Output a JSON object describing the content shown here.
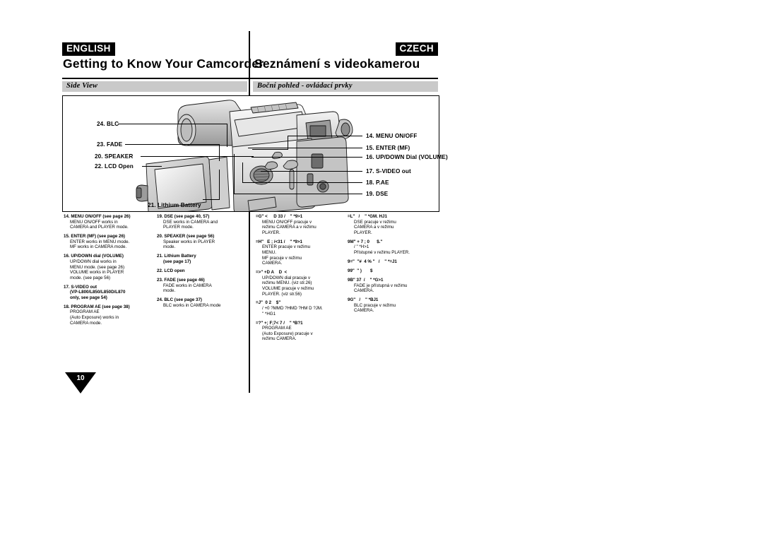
{
  "header": {
    "left_lang": "ENGLISH",
    "right_lang": "CZECH",
    "left_title": "Getting to Know Your Camcorder",
    "right_title": "Seznámení s videokamerou",
    "left_subbar": "Side View",
    "right_subbar": "Boční pohled - ovládací prvky"
  },
  "figure": {
    "labels": [
      {
        "id": "blc",
        "text": "24. BLC"
      },
      {
        "id": "fade",
        "text": "23. FADE"
      },
      {
        "id": "speaker",
        "text": "20. SPEAKER"
      },
      {
        "id": "lcd-open",
        "text": "22. LCD Open"
      },
      {
        "id": "menu",
        "text": "14. MENU ON/OFF"
      },
      {
        "id": "enter",
        "text": "15. ENTER (MF)"
      },
      {
        "id": "updown",
        "text": "16. UP/DOWN Dial (VOLUME)"
      },
      {
        "id": "svideo",
        "text": "17. S-VIDEO out"
      },
      {
        "id": "pae",
        "text": "18. P.AE"
      },
      {
        "id": "dse",
        "text": "19. DSE"
      },
      {
        "id": "battery",
        "text": "21. Lithium Battery"
      }
    ]
  },
  "english_col1": [
    {
      "head": "14. MENU ON/OFF (see page 26)",
      "body": "MENU ON/OFF works in\nCAMERA and PLAYER mode."
    },
    {
      "head": "15. ENTER (MF) (see page 26)",
      "body": "ENTER works in MENU mode.\nMF works in CAMERA mode."
    },
    {
      "head": "16. UP/DOWN dial (VOLUME)",
      "body": "UP/DOWN dial works in\nMENU mode. (see page 26)\nVOLUME works in PLAYER\nmode. (see page 56)"
    },
    {
      "head": "17. S-VIDEO out",
      "head2": "(VP-L800/L850/L850D/L870\nonly, see page 54)",
      "body": ""
    },
    {
      "head": "18. PROGRAM AE (see page 38)",
      "body": "PROGRAM AE\n(Auto Exposure) works in\nCAMERA mode."
    }
  ],
  "english_col2": [
    {
      "head": "19. DSE (see page 40, 57)",
      "body": "DSE works in CAMERA and\nPLAYER mode."
    },
    {
      "head": "20. SPEAKER (see page 56)",
      "body": "Speaker works in PLAYER\nmode."
    },
    {
      "head": "21. Lithium Battery",
      "head2": "(see page 17)",
      "body": ""
    },
    {
      "head": "22. LCD open",
      "body": ""
    },
    {
      "head": "23. FADE (see page 46)",
      "body": "FADE works in CAMERA\nmode."
    },
    {
      "head": "24. BLC (see page 37)",
      "body": "BLC works in CAMERA mode"
    }
  ],
  "czech_col1": [
    {
      "head": "=G\" <     D 33 /    \" *9>1",
      "body": "MENU ON/OFF pracuje v\nrežimu CAMERA a v  režimu\nPLAYER."
    },
    {
      "head": "=H\"   E ; /<31 /    \" *9>1",
      "body": "ENTER pracuje v režimu\nMENU.\nMF pracuje v režimu\nCAMERA."
    },
    {
      "head": "=>\" +D A    D  <",
      "body": "UP/DOWN dial pracuje v\nrežimu MENU. (viz str.26)\nVOLUME pracuje v režimu\nPLAYER. (viz str.56)"
    },
    {
      "head": "=J\"  0 2    $\"",
      "body": "/ +0 ?MMD ?HMD ?HM D ?JM.\n   \" *HG1"
    },
    {
      "head": "=?\" +; F;7< 7 /    \" *B?1",
      "body": "PROGRAM AE\n(Auto Exposure) pracuje v\nrežimu CAMERA."
    }
  ],
  "czech_col2": [
    {
      "head": "=L\"   /    \" *GM. HJ1",
      "body": "DSE pracuje v režimu\nCAMERA a v režimu\nPLAYER."
    },
    {
      "head": "9M\" + 7 ; 0      $.\"",
      "body": "/    \" *H>1\nPřístupné v režimu PLAYER."
    },
    {
      "head": "9=\"  \"#  4 % \"   /    \" *=J1",
      "body": ""
    },
    {
      "head": "99\"  \" )       $",
      "body": ""
    },
    {
      "head": "9B\" 37  /    \" *G>1",
      "body": "FADE je přístupná v režimu\nCAMERA."
    },
    {
      "head": "9G\"   /    \" *BJ1",
      "body": "BLC pracuje v režimu\nCAMERA."
    }
  ],
  "page_number": "10"
}
